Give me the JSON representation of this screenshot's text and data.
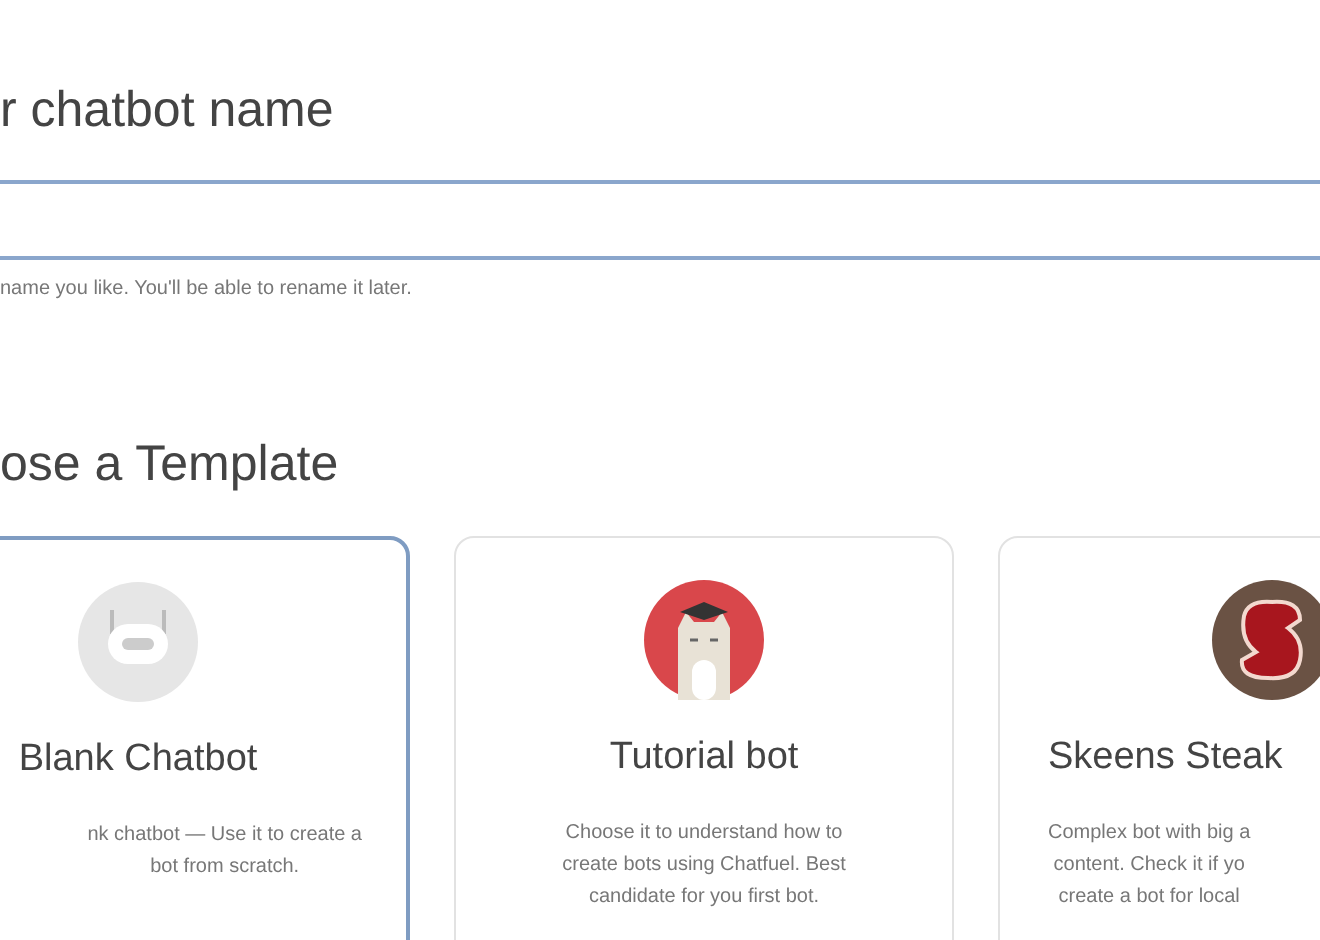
{
  "name_section": {
    "heading": "r chatbot name",
    "hint": "name you like. You'll be able to rename it later."
  },
  "template_section": {
    "heading": "ose a Template",
    "cards": [
      {
        "kind": "robot",
        "title": "Blank Chatbot",
        "desc_lines": [
          "nk chatbot — Use it to create a",
          "bot from scratch."
        ],
        "selected": true
      },
      {
        "kind": "cat",
        "title": "Tutorial bot",
        "desc_lines": [
          "Choose it to understand how to",
          "create bots using Chatfuel. Best",
          "candidate for you first bot."
        ],
        "selected": false
      },
      {
        "kind": "steak",
        "title": "Skeens Steak",
        "desc_lines": [
          "Complex bot with big a",
          "content. Check it if yo",
          "create a bot for local"
        ],
        "selected": false
      }
    ]
  }
}
